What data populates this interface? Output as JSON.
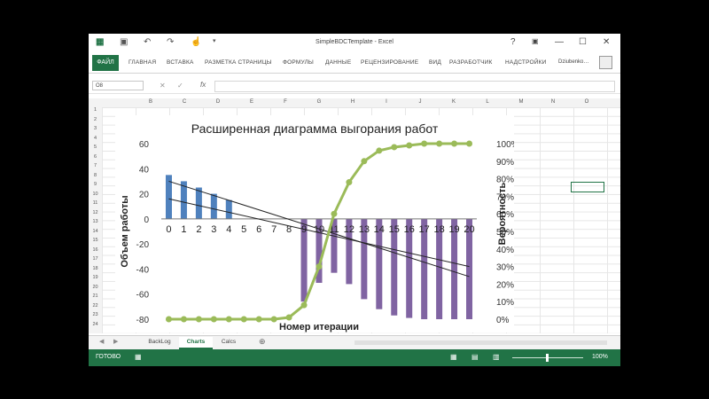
{
  "window": {
    "title": "SimpleBDCTemplate - Excel",
    "controls": {
      "help": "?",
      "ribbon_opts": "▣",
      "minimize": "—",
      "maximize": "☐",
      "close": "✕"
    }
  },
  "ribbon": {
    "file": "ФАЙЛ",
    "tabs": [
      "ГЛАВНАЯ",
      "ВСТАВКА",
      "РАЗМЕТКА СТРАНИЦЫ",
      "ФОРМУЛЫ",
      "ДАННЫЕ",
      "РЕЦЕНЗИРОВАНИЕ",
      "ВИД",
      "РАЗРАБОТЧИК",
      "НАДСТРОЙКИ"
    ],
    "user": "Dziubenko…"
  },
  "formula_bar": {
    "name_box": "O8",
    "fx": "fx",
    "value": ""
  },
  "columns": [
    "B",
    "C",
    "D",
    "E",
    "F",
    "G",
    "H",
    "I",
    "J",
    "K",
    "L",
    "M",
    "N",
    "O"
  ],
  "rows": [
    "1",
    "2",
    "3",
    "4",
    "5",
    "6",
    "7",
    "8",
    "9",
    "10",
    "11",
    "12",
    "13",
    "14",
    "15",
    "16",
    "17",
    "18",
    "19",
    "20",
    "21",
    "22",
    "23",
    "24"
  ],
  "sheet_tabs": [
    "BackLog",
    "Charts",
    "Calcs"
  ],
  "active_sheet": "Charts",
  "status": {
    "ready": "ГОТОВО",
    "zoom": "100%"
  },
  "chart_data": {
    "type": "bar",
    "title": "Расширенная диаграмма выгорания работ",
    "xlabel": "Номер итерации",
    "ylabel": "Объем работы",
    "y2label": "Вероятность",
    "categories": [
      0,
      1,
      2,
      3,
      4,
      5,
      6,
      7,
      8,
      9,
      10,
      11,
      12,
      13,
      14,
      15,
      16,
      17,
      18,
      19,
      20
    ],
    "ylim": [
      -80,
      60
    ],
    "yticks": [
      60,
      40,
      20,
      0,
      -20,
      -40,
      -60,
      -80
    ],
    "y2lim": [
      0,
      1
    ],
    "y2ticks": [
      "100%",
      "90%",
      "80%",
      "70%",
      "60%",
      "50%",
      "40%",
      "30%",
      "20%",
      "10%",
      "0%"
    ],
    "series": [
      {
        "kind": "bar",
        "color": "#4f81bd",
        "values": [
          35,
          30,
          25,
          20,
          15,
          0,
          0,
          0,
          0,
          0,
          0,
          0,
          0,
          0,
          0,
          0,
          0,
          0,
          0,
          0,
          0
        ]
      },
      {
        "kind": "bar",
        "color": "#8064a2",
        "values": [
          0,
          0,
          0,
          0,
          0,
          0,
          0,
          0,
          0,
          -66,
          -51,
          -43,
          -52,
          -64,
          -72,
          -77,
          -79,
          -80,
          -80,
          -80,
          -80
        ]
      },
      {
        "kind": "line",
        "axis": "right",
        "color": "#9bbb59",
        "values": [
          0,
          0,
          0,
          0,
          0,
          0,
          0,
          0,
          0.01,
          0.08,
          0.3,
          0.6,
          0.78,
          0.9,
          0.96,
          0.98,
          0.99,
          1,
          1,
          1,
          1
        ]
      }
    ],
    "trendlines": [
      {
        "color": "#222222",
        "x": [
          0,
          20
        ],
        "y": [
          30,
          -46
        ]
      },
      {
        "color": "#222222",
        "x": [
          0,
          20
        ],
        "y": [
          16,
          -38
        ]
      }
    ],
    "grid": false,
    "legend": "none"
  }
}
